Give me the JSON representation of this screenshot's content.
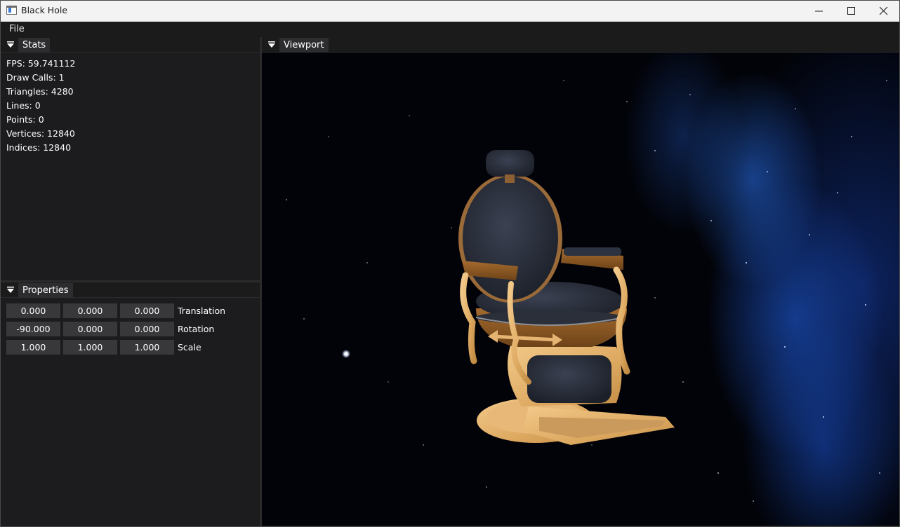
{
  "window": {
    "title": "Black Hole"
  },
  "menu": {
    "file": "File"
  },
  "stats": {
    "tab": "Stats",
    "fps": "FPS: 59.741112",
    "draw_calls": "Draw Calls: 1",
    "triangles": "Triangles: 4280",
    "lines": "Lines: 0",
    "points": "Points: 0",
    "vertices": "Vertices: 12840",
    "indices": "Indices: 12840"
  },
  "properties": {
    "tab": "Properties",
    "translation": {
      "label": "Translation",
      "x": "0.000",
      "y": "0.000",
      "z": "0.000"
    },
    "rotation": {
      "label": "Rotation",
      "x": "-90.000",
      "y": "0.000",
      "z": "0.000"
    },
    "scale": {
      "label": "Scale",
      "x": "1.000",
      "y": "1.000",
      "z": "1.000"
    }
  },
  "viewport": {
    "tab": "Viewport",
    "model": "barber-chair"
  },
  "colors": {
    "background": "#1e1e1e",
    "panel": "#1c1c1e",
    "field": "#38383b",
    "tab": "#2d2d30",
    "nebula": "#1e5fd0",
    "chair_leather": "#2a2f3d",
    "chair_gold": "#e3b170"
  }
}
